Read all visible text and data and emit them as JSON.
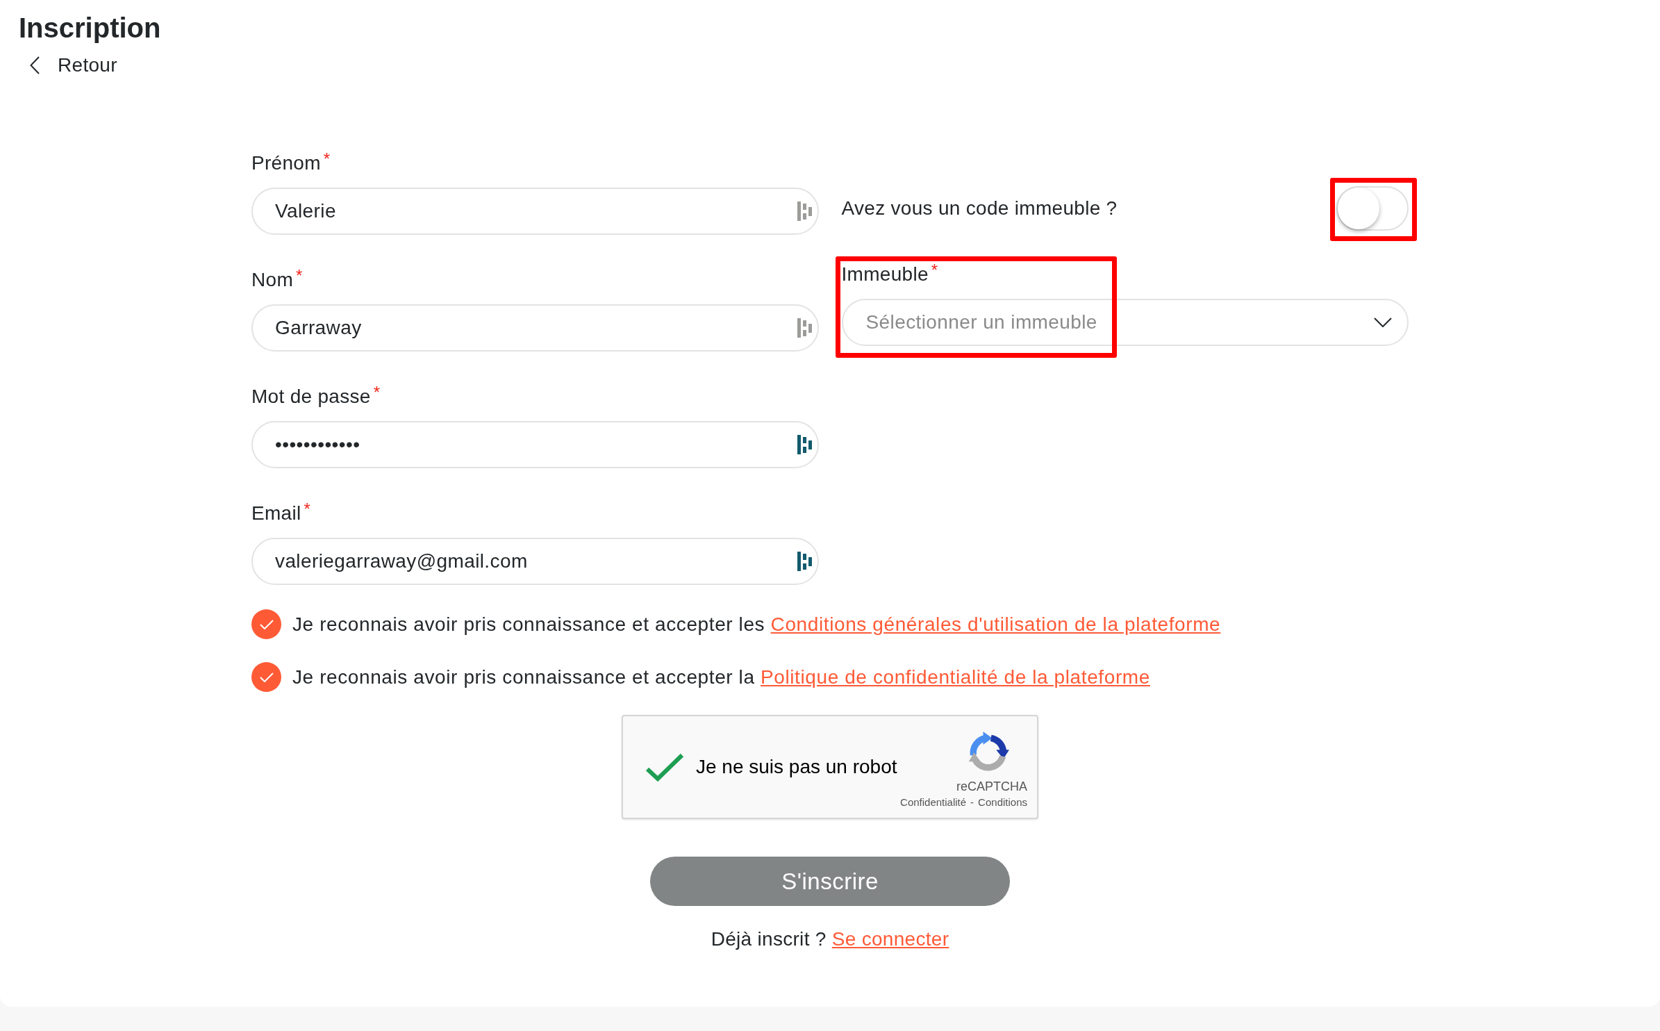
{
  "header": {
    "title": "Inscription",
    "back_link": {
      "label": "Retour"
    }
  },
  "form": {
    "fields": [
      {
        "label": "Prénom",
        "required_mark": "*",
        "value": "Valerie",
        "color": "#9b9b99"
      },
      {
        "label": "Nom",
        "required_mark": "*",
        "value": "Garraway",
        "color": "#9b9b99"
      },
      {
        "label": "Mot de passe",
        "required_mark": "*",
        "value": "••••••••••••",
        "color": "#125a6d"
      },
      {
        "label": "Email",
        "required_mark": "*",
        "value": "valeriegarraway@gmail.com",
        "color": "#125a6d"
      }
    ],
    "building_code": {
      "label": "Avez vous un code immeuble ?",
      "on": false,
      "highlighted": true
    },
    "building": {
      "label": "Immeuble",
      "required_mark": "*",
      "placeholder": "Sélectionner un immeuble",
      "highlighted": true
    },
    "consents": [
      {
        "text": "Je reconnais avoir pris connaissance et accepter les",
        "link": "Conditions générales d'utilisation de la plateforme",
        "checked": true
      },
      {
        "text": "Je reconnais avoir pris connaissance et accepter la",
        "link": "Politique de confidentialité de la plateforme",
        "checked": true
      }
    ],
    "captcha": {
      "label": "Je ne suis pas un robot",
      "checked": true,
      "brand": "reCAPTCHA",
      "links": [
        "Confidentialité",
        "Conditions"
      ],
      "separator": "-"
    },
    "submit": {
      "label": "S'inscrire"
    },
    "login_prompt": {
      "text": "Déjà inscrit ?",
      "link": "Se connecter"
    }
  }
}
